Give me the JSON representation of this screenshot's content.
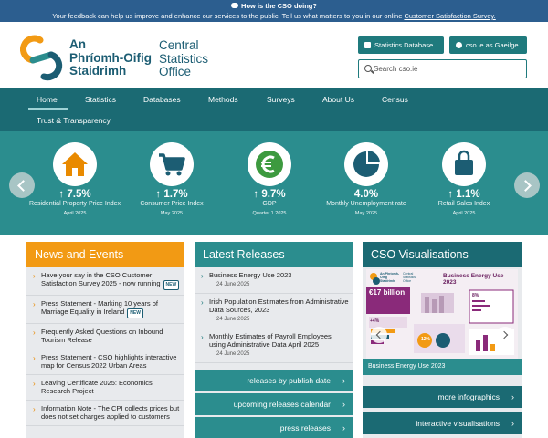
{
  "feedback": {
    "title": "How is the CSO doing?",
    "text": "Your feedback can help us improve and enhance our services to the public. Tell us what matters to you in our online ",
    "link": "Customer Satisfaction Survey."
  },
  "header": {
    "logo_ga_line1": "An",
    "logo_ga_line2": "Phríomh-Oifig",
    "logo_ga_line3": "Staidrimh",
    "logo_en_line1": "Central",
    "logo_en_line2": "Statistics",
    "logo_en_line3": "Office",
    "stats_db_label": "Statistics Database",
    "gaeilge_label": "cso.ie as Gaeilge",
    "search_placeholder": "Search cso.ie"
  },
  "nav": {
    "items": [
      "Home",
      "Statistics",
      "Databases",
      "Methods",
      "Surveys",
      "About Us",
      "Census"
    ],
    "second_row": "Trust & Transparency"
  },
  "stats": [
    {
      "icon": "house-icon",
      "value": "↑ 7.5%",
      "label": "Residential Property Price Index",
      "date": "April 2025"
    },
    {
      "icon": "shopping-cart-icon",
      "value": "↑ 1.7%",
      "label": "Consumer Price Index",
      "date": "May 2025"
    },
    {
      "icon": "euro-icon",
      "value": "↑ 9.7%",
      "label": "GDP",
      "date": "Quarter 1 2025"
    },
    {
      "icon": "pie-chart-icon",
      "value": "4.0%",
      "label": "Monthly Unemployment rate",
      "date": "May 2025"
    },
    {
      "icon": "shopping-bag-icon",
      "value": "↑ 1.1%",
      "label": "Retail Sales Index",
      "date": "April 2025"
    }
  ],
  "news": {
    "heading": "News and Events",
    "badge": "NEW",
    "items": [
      {
        "text": "Have your say in the CSO Customer Satisfaction Survey 2025 - now running"
      },
      {
        "text": "Press Statement - Marking 10 years of Marriage Equality in Ireland"
      },
      {
        "text": "Frequently Asked Questions on Inbound Tourism Release"
      },
      {
        "text": "Press Statement - CSO highlights interactive map for Census 2022 Urban Areas"
      },
      {
        "text": "Leaving Certificate 2025: Economics Research Project"
      },
      {
        "text": "Information Note - The CPI collects prices but does not set charges applied to customers"
      }
    ]
  },
  "releases": {
    "heading": "Latest Releases",
    "items": [
      {
        "title": "Business Energy Use 2023",
        "date": "24 June 2025"
      },
      {
        "title": "Irish Population Estimates from Administrative Data Sources, 2023",
        "date": "24 June 2025"
      },
      {
        "title": "Monthly Estimates of Payroll Employees using Administrative Data April 2025",
        "date": "24 June 2025"
      }
    ],
    "links": [
      "releases by publish date",
      "upcoming releases calendar",
      "press releases"
    ]
  },
  "visualisations": {
    "heading": "CSO Visualisations",
    "infographic": {
      "logo_ga": "An Phríomh-Oifig Staidrimh",
      "logo_en": "Central Statistics Office",
      "title": "Business Energy Use 2023",
      "big_value": "€17 billion",
      "pct_a": "+4%",
      "pct_b": "8%",
      "pct_c": "12%"
    },
    "caption": "Business Energy Use 2023",
    "links": [
      "more infographics",
      "interactive visualisations"
    ]
  },
  "colors": {
    "teal_dark": "#1b6a73",
    "teal": "#2b8d8e",
    "orange": "#f29a14",
    "feedback_blue": "#2c5e8f"
  }
}
